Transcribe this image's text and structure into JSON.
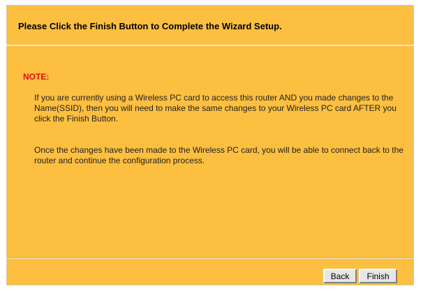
{
  "wizard": {
    "title": "Please Click the Finish Button to Complete the Wizard Setup.",
    "note_label": "NOTE:",
    "paragraph1": "If you are currently using a Wireless PC card to access this router AND you made changes to the Name(SSID), then you will need to make the same changes to your Wireless PC card AFTER you click the Finish Button.",
    "paragraph2": "Once the changes have been made to the Wireless PC card, you will be able to connect back to the router and continue the configuration process."
  },
  "buttons": {
    "back_label": "Back",
    "finish_label": "Finish"
  },
  "colors": {
    "panel_background": "#fcbf3f",
    "note_label": "#e20e0e"
  }
}
